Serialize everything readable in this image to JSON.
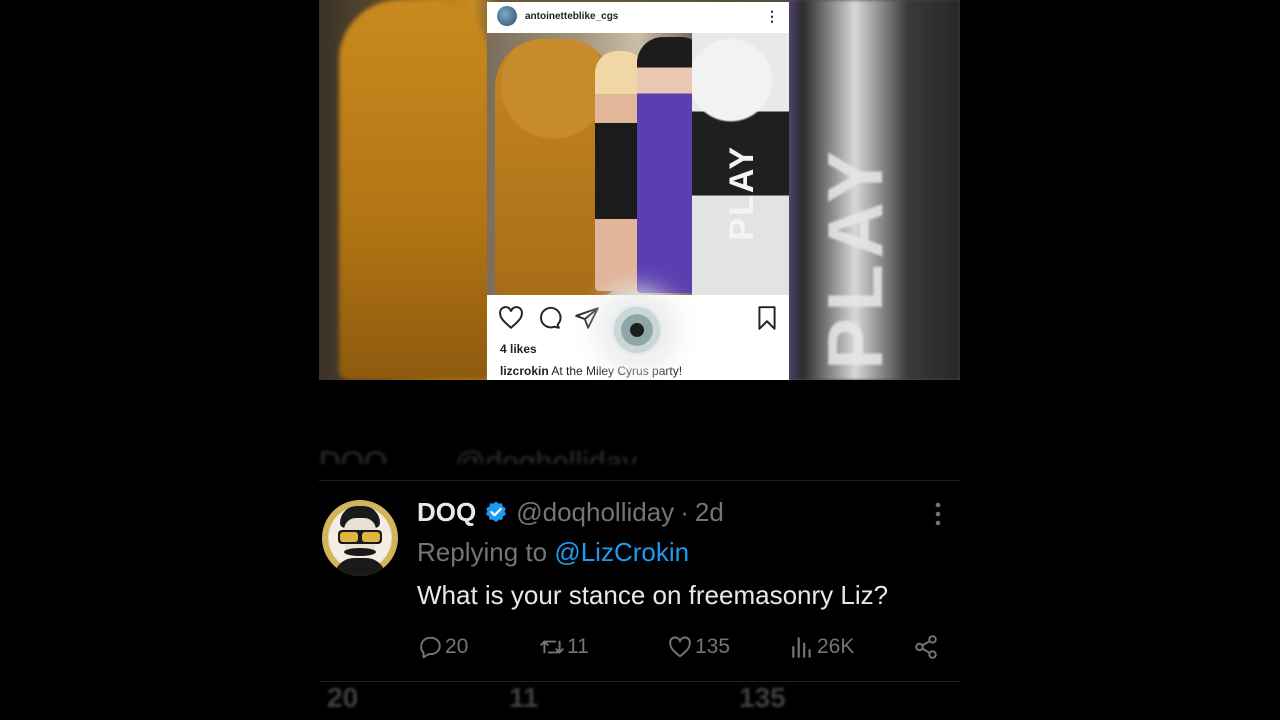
{
  "instagram": {
    "username": "antoinetteblike_cgs",
    "more_glyph": "⋮",
    "likes": "4 likes",
    "caption_user": "lizcrokin",
    "caption_text": " At the Miley Cyrus party!",
    "sign_text": "PLAY"
  },
  "tweet": {
    "display_name": "DOQ",
    "handle": "@doqholliday",
    "separator": "·",
    "time": "2d",
    "replying_prefix": "Replying to ",
    "replying_mention": "@LizCrokin",
    "text": "What is your stance on freemasonry Liz?",
    "counts": {
      "replies": "20",
      "retweets": "11",
      "likes": "135",
      "views": "26K"
    },
    "accent_color": "#1d9bf0"
  },
  "icons": [
    "heart-icon",
    "comment-icon",
    "share-icon",
    "bookmark-icon",
    "verified-badge-icon",
    "more-icon",
    "reply-icon",
    "retweet-icon",
    "like-icon",
    "views-icon",
    "share-node-icon"
  ]
}
